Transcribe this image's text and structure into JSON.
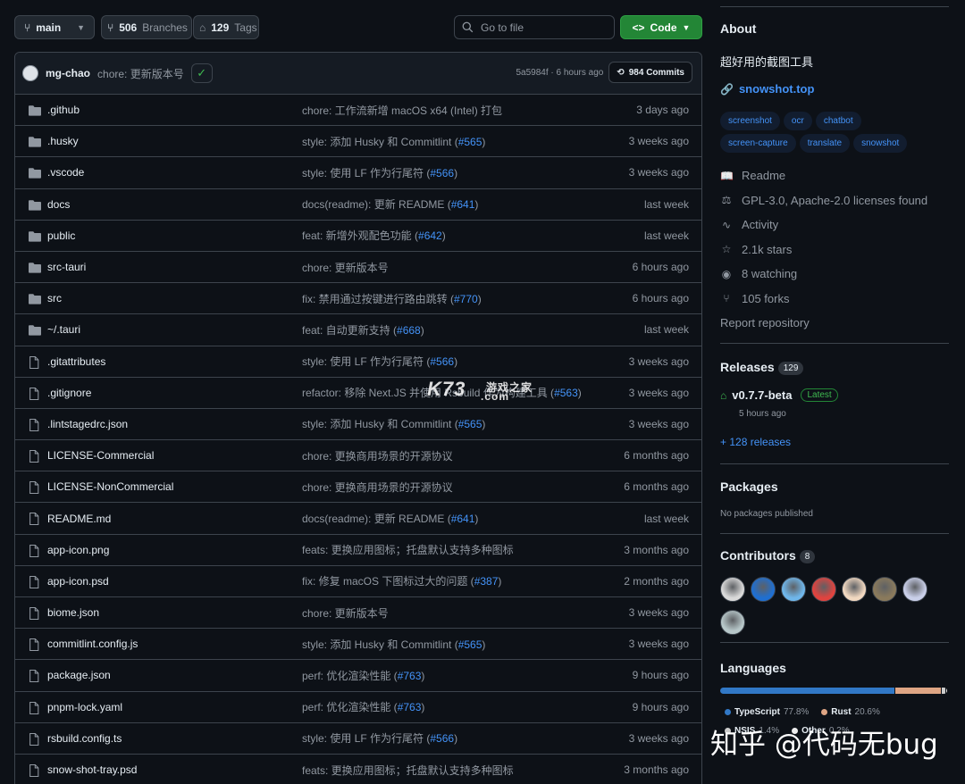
{
  "toolbar": {
    "branch": "main",
    "branches_count": "506",
    "branches_label": "Branches",
    "tags_count": "129",
    "tags_label": "Tags",
    "search_placeholder": "Go to file",
    "code_label": "Code"
  },
  "last_commit": {
    "author": "mg-chao",
    "message": "chore: 更新版本号",
    "hash_time": "5a5984f · 6 hours ago",
    "commits_label": "984 Commits"
  },
  "files": [
    {
      "name": ".github",
      "type": "dir",
      "msg": "chore: 工作流新增 macOS x64 (Intel) 打包",
      "pr": "",
      "date": "3 days ago"
    },
    {
      "name": ".husky",
      "type": "dir",
      "msg": "style: 添加 Husky 和 Commitlint (",
      "pr": "#565",
      "date": "3 weeks ago"
    },
    {
      "name": ".vscode",
      "type": "dir",
      "msg": "style: 使用 LF 作为行尾符 (",
      "pr": "#566",
      "date": "3 weeks ago"
    },
    {
      "name": "docs",
      "type": "dir",
      "msg": "docs(readme): 更新 README (",
      "pr": "#641",
      "date": "last week"
    },
    {
      "name": "public",
      "type": "dir",
      "msg": "feat: 新增外观配色功能 (",
      "pr": "#642",
      "date": "last week"
    },
    {
      "name": "src-tauri",
      "type": "dir",
      "msg": "chore: 更新版本号",
      "pr": "",
      "date": "6 hours ago"
    },
    {
      "name": "src",
      "type": "dir",
      "msg": "fix: 禁用通过按键进行路由跳转 (",
      "pr": "#770",
      "date": "6 hours ago"
    },
    {
      "name": "~/.tauri",
      "type": "dir",
      "msg": "feat: 自动更新支持 (",
      "pr": "#668",
      "date": "last week"
    },
    {
      "name": ".gitattributes",
      "type": "file",
      "msg": "style: 使用 LF 作为行尾符 (",
      "pr": "#566",
      "date": "3 weeks ago"
    },
    {
      "name": ".gitignore",
      "type": "file",
      "msg": "refactor: 移除 Next.JS 并使用 Rsbuild 作为构建工具 (",
      "pr": "#563",
      "date": "3 weeks ago"
    },
    {
      "name": ".lintstagedrc.json",
      "type": "file",
      "msg": "style: 添加 Husky 和 Commitlint (",
      "pr": "#565",
      "date": "3 weeks ago"
    },
    {
      "name": "LICENSE-Commercial",
      "type": "file",
      "msg": "chore: 更换商用场景的开源协议",
      "pr": "",
      "date": "6 months ago"
    },
    {
      "name": "LICENSE-NonCommercial",
      "type": "file",
      "msg": "chore: 更换商用场景的开源协议",
      "pr": "",
      "date": "6 months ago"
    },
    {
      "name": "README.md",
      "type": "file",
      "msg": "docs(readme): 更新 README (",
      "pr": "#641",
      "date": "last week"
    },
    {
      "name": "app-icon.png",
      "type": "file",
      "msg": "feats: 更换应用图标；托盘默认支持多种图标",
      "pr": "",
      "date": "3 months ago"
    },
    {
      "name": "app-icon.psd",
      "type": "file",
      "msg": "fix: 修复 macOS 下图标过大的问题 (",
      "pr": "#387",
      "date": "2 months ago"
    },
    {
      "name": "biome.json",
      "type": "file",
      "msg": "chore: 更新版本号",
      "pr": "",
      "date": "3 weeks ago"
    },
    {
      "name": "commitlint.config.js",
      "type": "file",
      "msg": "style: 添加 Husky 和 Commitlint (",
      "pr": "#565",
      "date": "3 weeks ago"
    },
    {
      "name": "package.json",
      "type": "file",
      "msg": "perf: 优化渲染性能 (",
      "pr": "#763",
      "date": "9 hours ago"
    },
    {
      "name": "pnpm-lock.yaml",
      "type": "file",
      "msg": "perf: 优化渲染性能 (",
      "pr": "#763",
      "date": "9 hours ago"
    },
    {
      "name": "rsbuild.config.ts",
      "type": "file",
      "msg": "style: 使用 LF 作为行尾符 (",
      "pr": "#566",
      "date": "3 weeks ago"
    },
    {
      "name": "snow-shot-tray.psd",
      "type": "file",
      "msg": "feats: 更换应用图标；托盘默认支持多种图标",
      "pr": "",
      "date": "3 months ago"
    }
  ],
  "about": {
    "title": "About",
    "description": "超好用的截图工具",
    "link": "snowshot.top",
    "topics": [
      "screenshot",
      "ocr",
      "chatbot",
      "screen-capture",
      "translate",
      "snowshot"
    ],
    "meta": [
      {
        "icon": "book-icon",
        "glyph": "📖",
        "label": "Readme"
      },
      {
        "icon": "law-icon",
        "glyph": "⚖",
        "label": "GPL-3.0, Apache-2.0 licenses found"
      },
      {
        "icon": "pulse-icon",
        "glyph": "∿",
        "label": "Activity"
      },
      {
        "icon": "star-icon",
        "glyph": "☆",
        "label": "2.1k stars"
      },
      {
        "icon": "eye-icon",
        "glyph": "◉",
        "label": "8 watching"
      },
      {
        "icon": "fork-icon",
        "glyph": "⑂",
        "label": "105 forks"
      }
    ],
    "report": "Report repository"
  },
  "releases": {
    "title": "Releases",
    "count": "129",
    "latest_name": "v0.7.7-beta",
    "latest_badge": "Latest",
    "latest_time": "5 hours ago",
    "more": "+ 128 releases"
  },
  "packages": {
    "title": "Packages",
    "empty": "No packages published"
  },
  "contributors": {
    "title": "Contributors",
    "count": "8",
    "colors": [
      "#d9d9d9",
      "#1f6fd1",
      "#6fb6ea",
      "#e0433f",
      "#f1d8c0",
      "#8a7a5c",
      "#c9cfe9",
      "#b7c7c9"
    ]
  },
  "languages": {
    "title": "Languages",
    "items": [
      {
        "name": "TypeScript",
        "percent": "77.8%",
        "value": 77.8,
        "color": "#3178c6"
      },
      {
        "name": "Rust",
        "percent": "20.6%",
        "value": 20.6,
        "color": "#dea584"
      },
      {
        "name": "NSIS",
        "percent": "1.4%",
        "value": 1.4,
        "color": "#cccccc"
      },
      {
        "name": "Other",
        "percent": "0.2%",
        "value": 0.2,
        "color": "#ededed"
      }
    ]
  },
  "watermarks": {
    "center": "K73",
    "center_sub": "游戏之家",
    "center_domain": ".com",
    "bottom": "知乎 @代码无bug"
  }
}
